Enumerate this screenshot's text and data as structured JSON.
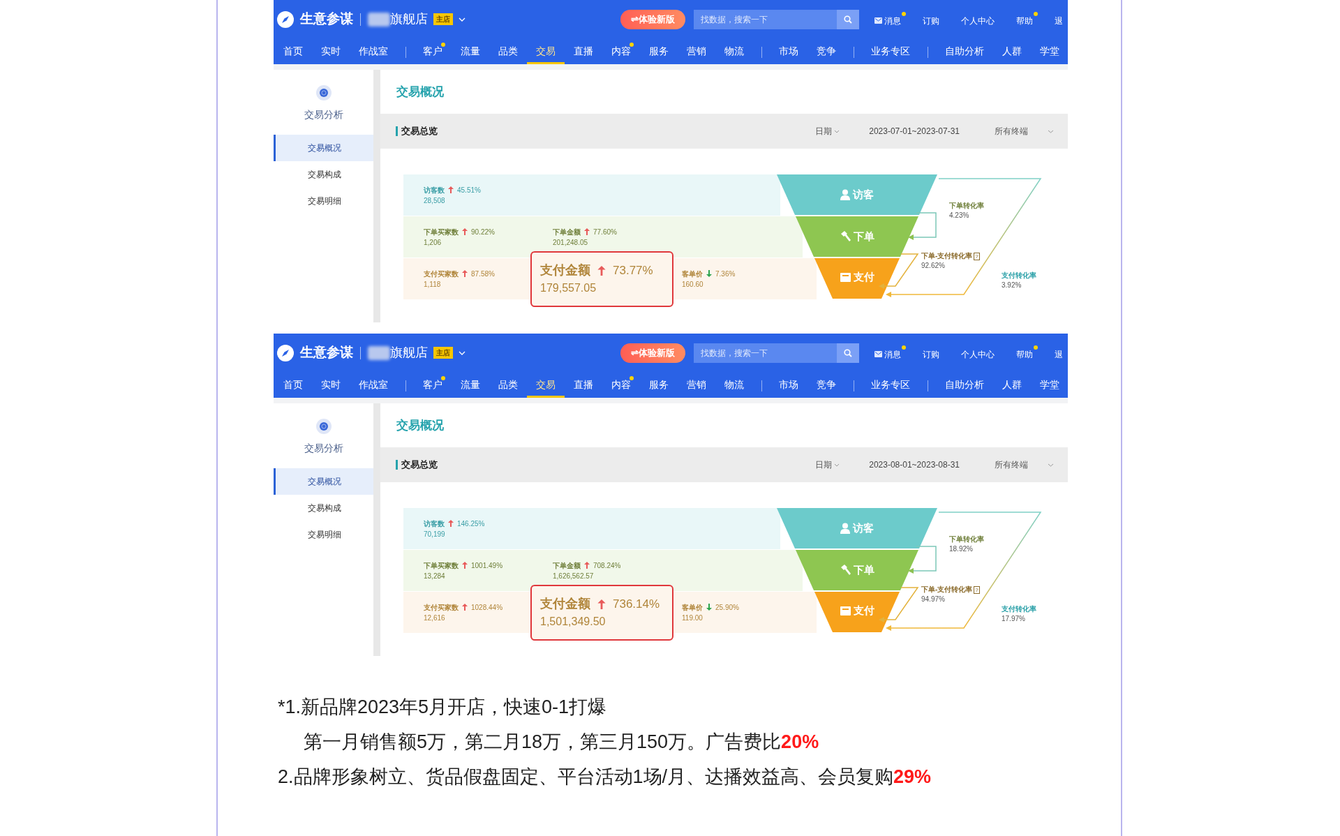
{
  "panels": [
    {
      "header": {
        "logo_text": "生意参谋",
        "store_name": "旗舰店",
        "store_badge": "主店",
        "new_version_button": "⇌体验新版",
        "search_placeholder": "找数据，搜索一下",
        "links": [
          {
            "label": "消息",
            "kind": "message",
            "dot": true
          },
          {
            "label": "订购",
            "kind": "plain",
            "dot": false
          },
          {
            "label": "个人中心",
            "kind": "plain",
            "dot": false
          },
          {
            "label": "帮助",
            "kind": "plain",
            "dot": true
          },
          {
            "label": "退",
            "kind": "plain",
            "dot": false
          }
        ],
        "nav": [
          {
            "label": "首页",
            "selected": false,
            "dot": false,
            "divider_before": false
          },
          {
            "label": "实时",
            "selected": false,
            "dot": false,
            "divider_before": false
          },
          {
            "label": "作战室",
            "selected": false,
            "dot": false,
            "divider_before": false
          },
          {
            "label": "客户",
            "selected": false,
            "dot": true,
            "divider_before": true
          },
          {
            "label": "流量",
            "selected": false,
            "dot": false,
            "divider_before": false
          },
          {
            "label": "品类",
            "selected": false,
            "dot": false,
            "divider_before": false
          },
          {
            "label": "交易",
            "selected": true,
            "dot": false,
            "divider_before": false
          },
          {
            "label": "直播",
            "selected": false,
            "dot": false,
            "divider_before": false
          },
          {
            "label": "内容",
            "selected": false,
            "dot": true,
            "divider_before": false
          },
          {
            "label": "服务",
            "selected": false,
            "dot": false,
            "divider_before": false
          },
          {
            "label": "营销",
            "selected": false,
            "dot": false,
            "divider_before": false
          },
          {
            "label": "物流",
            "selected": false,
            "dot": false,
            "divider_before": false
          },
          {
            "label": "市场",
            "selected": false,
            "dot": false,
            "divider_before": true
          },
          {
            "label": "竞争",
            "selected": false,
            "dot": false,
            "divider_before": false
          },
          {
            "label": "业务专区",
            "selected": false,
            "dot": false,
            "divider_before": true
          },
          {
            "label": "自助分析",
            "selected": false,
            "dot": false,
            "divider_before": true
          },
          {
            "label": "人群",
            "selected": false,
            "dot": false,
            "divider_before": false
          },
          {
            "label": "学堂",
            "selected": false,
            "dot": false,
            "divider_before": false
          }
        ]
      },
      "sidebar": {
        "title": "交易分析",
        "items": [
          {
            "label": "交易概况",
            "selected": true
          },
          {
            "label": "交易构成",
            "selected": false
          },
          {
            "label": "交易明细",
            "selected": false
          }
        ]
      },
      "main": {
        "title": "交易概况",
        "section_title": "交易总览",
        "date_label": "日期",
        "date_range": "2023-07-01~2023-07-31",
        "terminal_label": "所有终端",
        "funnel": {
          "rows": [
            {
              "kind": "visitor",
              "metrics": [
                {
                  "kind": "normal",
                  "label": "访客数",
                  "rising": true,
                  "change": "45.51%",
                  "value": "28,508"
                }
              ]
            },
            {
              "kind": "order",
              "metrics": [
                {
                  "kind": "normal",
                  "label": "下单买家数",
                  "rising": true,
                  "change": "90.22%",
                  "value": "1,206"
                },
                {
                  "kind": "normal",
                  "label": "下单金额",
                  "rising": true,
                  "change": "77.60%",
                  "value": "201,248.05"
                }
              ]
            },
            {
              "kind": "pay",
              "metrics": [
                {
                  "kind": "normal",
                  "label": "支付买家数",
                  "rising": true,
                  "change": "87.58%",
                  "value": "1,118"
                },
                {
                  "kind": "highlight",
                  "label": "支付金额",
                  "rising": true,
                  "change": "73.77%",
                  "value": "179,557.05"
                },
                {
                  "kind": "normal",
                  "label": "客单价",
                  "rising": false,
                  "change": "7.36%",
                  "value": "160.60"
                }
              ]
            }
          ],
          "stages": [
            {
              "kind": "visitor",
              "label": "访客",
              "color": "#6ccbcb"
            },
            {
              "kind": "order",
              "label": "下单",
              "color": "#8ec651"
            },
            {
              "kind": "pay",
              "label": "支付",
              "color": "#f7a21b"
            }
          ],
          "rates": [
            {
              "kind": "order",
              "label": "下单转化率",
              "value": "4.23%"
            },
            {
              "kind": "pay_from_order",
              "label": "下单-支付转化率",
              "help": "?",
              "value": "92.62%"
            },
            {
              "kind": "pay",
              "label": "支付转化率",
              "value": "3.92%"
            }
          ]
        }
      }
    },
    {
      "header": {
        "logo_text": "生意参谋",
        "store_name": "旗舰店",
        "store_badge": "主店",
        "new_version_button": "⇌体验新版",
        "search_placeholder": "找数据，搜索一下",
        "links": [
          {
            "label": "消息",
            "kind": "message",
            "dot": true
          },
          {
            "label": "订购",
            "kind": "plain",
            "dot": false
          },
          {
            "label": "个人中心",
            "kind": "plain",
            "dot": false
          },
          {
            "label": "帮助",
            "kind": "plain",
            "dot": true
          },
          {
            "label": "退",
            "kind": "plain",
            "dot": false
          }
        ],
        "nav": [
          {
            "label": "首页",
            "selected": false,
            "dot": false,
            "divider_before": false
          },
          {
            "label": "实时",
            "selected": false,
            "dot": false,
            "divider_before": false
          },
          {
            "label": "作战室",
            "selected": false,
            "dot": false,
            "divider_before": false
          },
          {
            "label": "客户",
            "selected": false,
            "dot": true,
            "divider_before": true
          },
          {
            "label": "流量",
            "selected": false,
            "dot": false,
            "divider_before": false
          },
          {
            "label": "品类",
            "selected": false,
            "dot": false,
            "divider_before": false
          },
          {
            "label": "交易",
            "selected": true,
            "dot": false,
            "divider_before": false
          },
          {
            "label": "直播",
            "selected": false,
            "dot": false,
            "divider_before": false
          },
          {
            "label": "内容",
            "selected": false,
            "dot": true,
            "divider_before": false
          },
          {
            "label": "服务",
            "selected": false,
            "dot": false,
            "divider_before": false
          },
          {
            "label": "营销",
            "selected": false,
            "dot": false,
            "divider_before": false
          },
          {
            "label": "物流",
            "selected": false,
            "dot": false,
            "divider_before": false
          },
          {
            "label": "市场",
            "selected": false,
            "dot": false,
            "divider_before": true
          },
          {
            "label": "竞争",
            "selected": false,
            "dot": false,
            "divider_before": false
          },
          {
            "label": "业务专区",
            "selected": false,
            "dot": false,
            "divider_before": true
          },
          {
            "label": "自助分析",
            "selected": false,
            "dot": false,
            "divider_before": true
          },
          {
            "label": "人群",
            "selected": false,
            "dot": false,
            "divider_before": false
          },
          {
            "label": "学堂",
            "selected": false,
            "dot": false,
            "divider_before": false
          }
        ]
      },
      "sidebar": {
        "title": "交易分析",
        "items": [
          {
            "label": "交易概况",
            "selected": true
          },
          {
            "label": "交易构成",
            "selected": false
          },
          {
            "label": "交易明细",
            "selected": false
          }
        ]
      },
      "main": {
        "title": "交易概况",
        "section_title": "交易总览",
        "date_label": "日期",
        "date_range": "2023-08-01~2023-08-31",
        "terminal_label": "所有终端",
        "funnel": {
          "rows": [
            {
              "kind": "visitor",
              "metrics": [
                {
                  "kind": "normal",
                  "label": "访客数",
                  "rising": true,
                  "change": "146.25%",
                  "value": "70,199"
                }
              ]
            },
            {
              "kind": "order",
              "metrics": [
                {
                  "kind": "normal",
                  "label": "下单买家数",
                  "rising": true,
                  "change": "1001.49%",
                  "value": "13,284"
                },
                {
                  "kind": "normal",
                  "label": "下单金额",
                  "rising": true,
                  "change": "708.24%",
                  "value": "1,626,562.57"
                }
              ]
            },
            {
              "kind": "pay",
              "metrics": [
                {
                  "kind": "normal",
                  "label": "支付买家数",
                  "rising": true,
                  "change": "1028.44%",
                  "value": "12,616"
                },
                {
                  "kind": "highlight",
                  "label": "支付金额",
                  "rising": true,
                  "change": "736.14%",
                  "value": "1,501,349.50"
                },
                {
                  "kind": "normal",
                  "label": "客单价",
                  "rising": false,
                  "change": "25.90%",
                  "value": "119.00"
                }
              ]
            }
          ],
          "stages": [
            {
              "kind": "visitor",
              "label": "访客",
              "color": "#6ccbcb"
            },
            {
              "kind": "order",
              "label": "下单",
              "color": "#8ec651"
            },
            {
              "kind": "pay",
              "label": "支付",
              "color": "#f7a21b"
            }
          ],
          "rates": [
            {
              "kind": "order",
              "label": "下单转化率",
              "value": "18.92%"
            },
            {
              "kind": "pay_from_order",
              "label": "下单-支付转化率",
              "help": "?",
              "value": "94.97%"
            },
            {
              "kind": "pay",
              "label": "支付转化率",
              "value": "17.97%"
            }
          ]
        }
      }
    }
  ],
  "notes": [
    {
      "kind": "item",
      "text": "*1.新品牌2023年5月开店，快速0-1打爆"
    },
    {
      "kind": "continuation",
      "text": "第一月销售额5万，第二月18万，第三月150万。广告费比**20%**"
    },
    {
      "kind": "item",
      "text": "2.品牌形象树立、货品假盘固定、平台活动1场/月、达播效益高、会员复购**29%**"
    }
  ]
}
